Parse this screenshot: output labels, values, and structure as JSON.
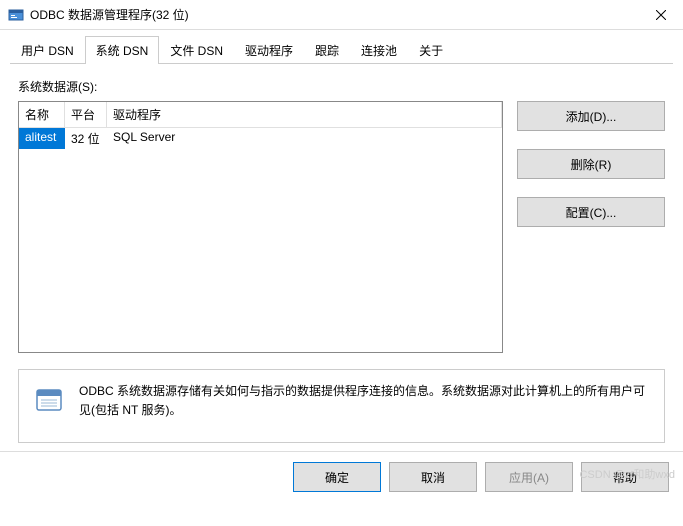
{
  "window": {
    "title": "ODBC 数据源管理程序(32 位)"
  },
  "tabs": {
    "items": [
      {
        "label": "用户 DSN"
      },
      {
        "label": "系统 DSN"
      },
      {
        "label": "文件 DSN"
      },
      {
        "label": "驱动程序"
      },
      {
        "label": "跟踪"
      },
      {
        "label": "连接池"
      },
      {
        "label": "关于"
      }
    ],
    "active_index": 1
  },
  "content": {
    "list_label": "系统数据源(S):",
    "columns": {
      "name": "名称",
      "platform": "平台",
      "driver": "驱动程序"
    },
    "rows": [
      {
        "name": "alitest",
        "platform": "32 位",
        "driver": "SQL Server"
      }
    ],
    "buttons": {
      "add": "添加(D)...",
      "remove": "删除(R)",
      "configure": "配置(C)..."
    },
    "info": "ODBC 系统数据源存储有关如何与指示的数据提供程序连接的信息。系统数据源对此计算机上的所有用户可见(包括 NT 服务)。"
  },
  "footer": {
    "ok": "确定",
    "cancel": "取消",
    "apply": "应用(A)",
    "help": "帮助"
  },
  "watermark": "CSDN @zt和助wxd"
}
